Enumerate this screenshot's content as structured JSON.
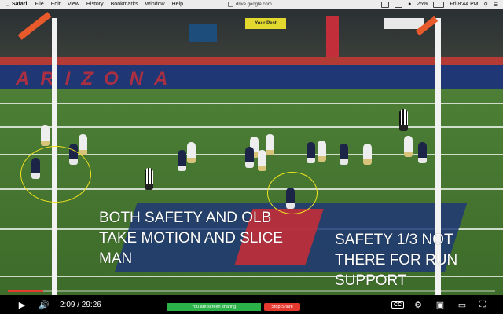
{
  "menubar": {
    "app_name": "Safari",
    "menus": [
      "File",
      "Edit",
      "View",
      "History",
      "Bookmarks",
      "Window",
      "Help"
    ],
    "url": "drive.google.com",
    "battery": "25%",
    "clock": "Fri 8:44 PM"
  },
  "video": {
    "stand_banner": "Your Pest",
    "endzone_text": "ARIZONA",
    "annotations": {
      "left": [
        "BOTH SAFETY AND OLB",
        "TAKE MOTION AND SLICE",
        "MAN"
      ],
      "right": [
        "SAFETY 1/3 NOT",
        "THERE FOR RUN",
        "SUPPORT"
      ]
    },
    "annotation_color": "#f1e21f"
  },
  "player": {
    "current_time": "2:09",
    "duration": "29:26",
    "time_display": "2:09 / 29:26",
    "progress_fraction": 0.073,
    "progress_color": "#e53b2e",
    "cc_label": "CC"
  },
  "screen_share": {
    "message": "You are screen sharing",
    "stop_label": "Stop Share"
  }
}
